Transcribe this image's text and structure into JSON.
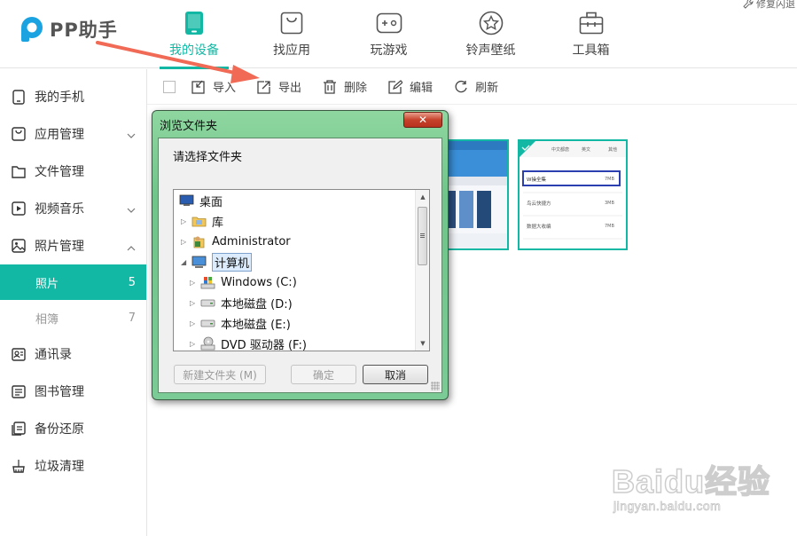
{
  "app": {
    "logo_text": "PP助手",
    "top_right": "修复闪退"
  },
  "nav": [
    {
      "label": "我的设备",
      "icon": "phone-icon",
      "active": true
    },
    {
      "label": "找应用",
      "icon": "bag-icon"
    },
    {
      "label": "玩游戏",
      "icon": "gamepad-icon"
    },
    {
      "label": "铃声壁纸",
      "icon": "star-icon"
    },
    {
      "label": "工具箱",
      "icon": "toolbox-icon"
    }
  ],
  "sidebar": {
    "items": [
      {
        "label": "我的手机",
        "icon": "phone-icon"
      },
      {
        "label": "应用管理",
        "icon": "bag-icon",
        "chevron": "down"
      },
      {
        "label": "文件管理",
        "icon": "folder-icon"
      },
      {
        "label": "视频音乐",
        "icon": "play-icon",
        "chevron": "down"
      },
      {
        "label": "照片管理",
        "icon": "photo-icon",
        "chevron": "up"
      }
    ],
    "sub_items": [
      {
        "label": "照片",
        "count": "5",
        "active": true
      },
      {
        "label": "相簿",
        "count": "7"
      }
    ],
    "items_after": [
      {
        "label": "通讯录",
        "icon": "contacts-icon"
      },
      {
        "label": "图书管理",
        "icon": "book-icon"
      },
      {
        "label": "备份还原",
        "icon": "backup-icon"
      },
      {
        "label": "垃圾清理",
        "icon": "broom-icon"
      }
    ]
  },
  "toolbar": {
    "import": "导入",
    "export": "导出",
    "delete": "删除",
    "edit": "编辑",
    "refresh": "刷新"
  },
  "thumb2": {
    "tabs": [
      "中文都唐",
      "英文",
      "其他"
    ],
    "rows": [
      {
        "name": "W操全集",
        "size": "7MB"
      },
      {
        "name": "鸟云快捷方",
        "size": "3MB"
      },
      {
        "name": "数据大收编",
        "size": "7MB"
      }
    ]
  },
  "dialog": {
    "title": "浏览文件夹",
    "close": "✕",
    "prompt": "请选择文件夹",
    "tree": [
      {
        "label": "桌面",
        "icon": "desktop-icon",
        "level": 0,
        "expander": ""
      },
      {
        "label": "库",
        "icon": "library-icon",
        "level": 0,
        "expander": "▷"
      },
      {
        "label": "Administrator",
        "icon": "user-folder-icon",
        "level": 0,
        "expander": "▷"
      },
      {
        "label": "计算机",
        "icon": "computer-icon",
        "level": 0,
        "expander": "◢",
        "selected": true
      },
      {
        "label": "Windows (C:)",
        "icon": "windows-drive-icon",
        "level": 1,
        "expander": "▷"
      },
      {
        "label": "本地磁盘 (D:)",
        "icon": "disk-icon",
        "level": 1,
        "expander": "▷"
      },
      {
        "label": "本地磁盘 (E:)",
        "icon": "disk-icon",
        "level": 1,
        "expander": "▷"
      },
      {
        "label": "DVD 驱动器 (F:)",
        "icon": "dvd-icon",
        "level": 1,
        "expander": "▷"
      }
    ],
    "new_folder": "新建文件夹 (M)",
    "ok": "确定",
    "cancel": "取消"
  },
  "watermark": {
    "main": "Baidu经验",
    "url": "jingyan.baidu.com"
  },
  "colors": {
    "accent": "#13b8a4",
    "arrow": "#f06a55"
  }
}
